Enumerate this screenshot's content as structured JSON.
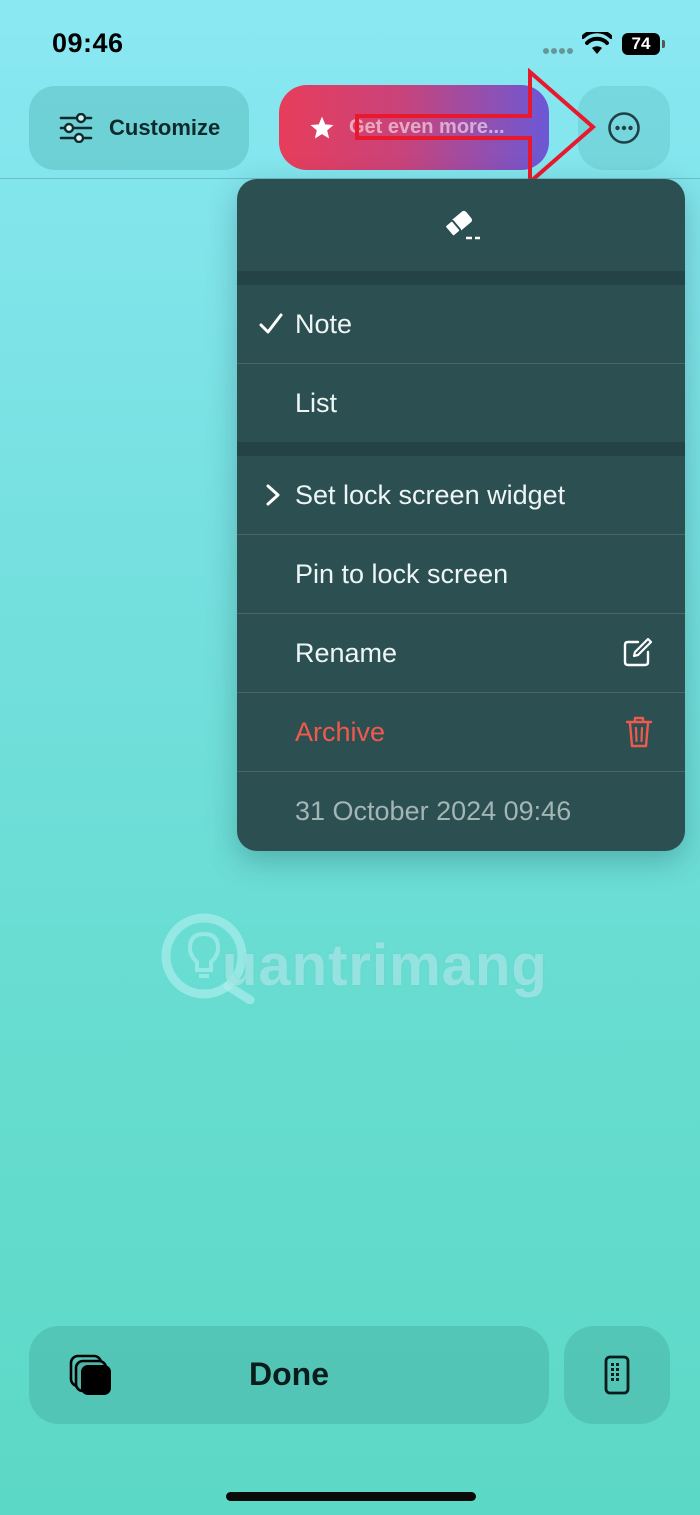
{
  "status_bar": {
    "time": "09:46",
    "battery": "74"
  },
  "toolbar": {
    "customize_label": "Customize",
    "upgrade_label": "Get even more...",
    "more_icon": "ellipsis-circle-icon"
  },
  "menu": {
    "header_icon": "eraser-icon",
    "mode_items": [
      {
        "label": "Note",
        "checked": true
      },
      {
        "label": "List",
        "checked": false
      }
    ],
    "action_items": [
      {
        "label": "Set lock screen widget",
        "icon": "chevron-right-icon"
      },
      {
        "label": "Pin to lock screen"
      },
      {
        "label": "Rename",
        "icon": "edit-icon"
      },
      {
        "label": "Archive",
        "icon": "trash-icon",
        "color": "#ef5a4c"
      }
    ],
    "timestamp": "31 October 2024 09:46"
  },
  "watermark": {
    "text": "uantrimang"
  },
  "bottom_bar": {
    "done_label": "Done"
  },
  "colors": {
    "menu_bg": "#2c4f52",
    "danger": "#ef5a4c",
    "annotation_arrow": "#e8192c"
  }
}
